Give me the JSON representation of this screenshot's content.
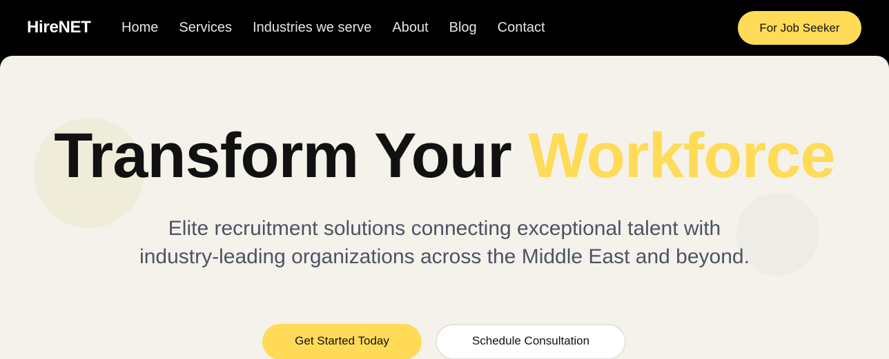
{
  "brand": {
    "name": "HireNET"
  },
  "nav": {
    "links": [
      "Home",
      "Services",
      "Industries we serve",
      "About",
      "Blog",
      "Contact"
    ],
    "cta_label": "For Job Seeker"
  },
  "hero": {
    "headline_main": "Transform Your ",
    "headline_accent": "Workforce",
    "subtitle_line1": "Elite recruitment solutions connecting exceptional talent with",
    "subtitle_line2": "industry-leading organizations across the Middle East and beyond.",
    "primary_cta": "Get Started Today",
    "secondary_cta": "Schedule Consultation"
  },
  "colors": {
    "nav_background": "#000000",
    "hero_background": "#f4f2eb",
    "accent_yellow": "#ffdb58",
    "subtitle_gray": "#4c5361"
  }
}
